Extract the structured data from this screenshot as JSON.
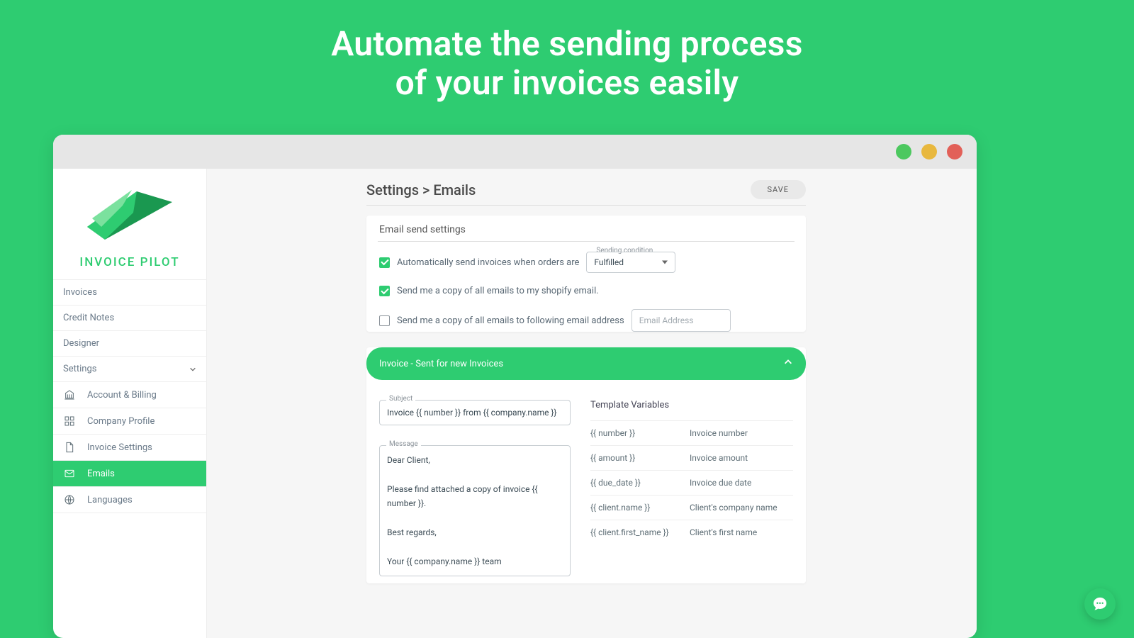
{
  "hero": {
    "line1": "Automate the sending process",
    "line2": "of your invoices easily"
  },
  "brand": "INVOICE PILOT",
  "sidebar": {
    "items": [
      "Invoices",
      "Credit Notes",
      "Designer"
    ],
    "settings_label": "Settings",
    "sub": {
      "account": "Account & Billing",
      "company": "Company Profile",
      "invoice": "Invoice Settings",
      "emails": "Emails",
      "languages": "Languages"
    }
  },
  "page": {
    "breadcrumb": "Settings > Emails",
    "save": "SAVE"
  },
  "send_settings": {
    "title": "Email send settings",
    "auto_label": "Automatically send invoices when orders are",
    "condition_label": "Sending condition",
    "condition_value": "Fulfilled",
    "copy_shopify": "Send me a copy of all emails to my shopify email.",
    "copy_custom": "Send me a copy of all emails to following email address",
    "email_placeholder": "Email Address"
  },
  "accordion": {
    "title": "Invoice - Sent for new Invoices"
  },
  "template": {
    "subject_label": "Subject",
    "subject_value": "Invoice {{ number }} from {{ company.name }}",
    "message_label": "Message",
    "message_value": "Dear Client,\n\nPlease find attached a copy of invoice {{ number }}.\n\nBest regards,\n\nYour {{ company.name }} team",
    "vars_title": "Template Variables",
    "vars": [
      {
        "key": "{{ number }}",
        "desc": "Invoice number"
      },
      {
        "key": "{{ amount }}",
        "desc": "Invoice amount"
      },
      {
        "key": "{{ due_date }}",
        "desc": "Invoice due date"
      },
      {
        "key": "{{ client.name }}",
        "desc": "Client's company name"
      },
      {
        "key": "{{ client.first_name }}",
        "desc": "Client's first name"
      }
    ]
  }
}
